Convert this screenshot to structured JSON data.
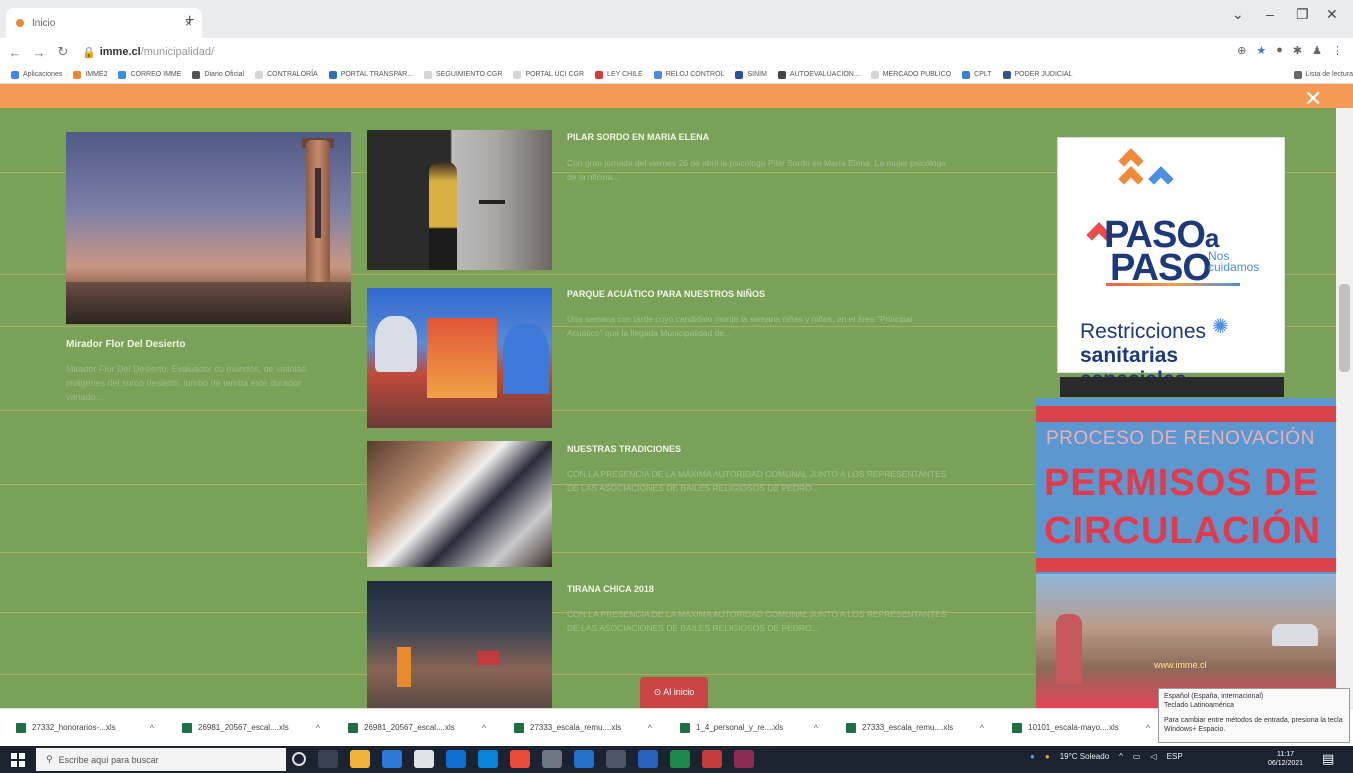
{
  "browser": {
    "tab_title": "Inicio",
    "tab_close": "×",
    "new_tab": "+",
    "window_controls": [
      "⌄",
      "–",
      "❐",
      "✕"
    ],
    "url_host": "imme.cl",
    "url_path": "/municipalidad/",
    "bookmarks": [
      {
        "label": "Aplicaciones",
        "color": "#4285f4"
      },
      {
        "label": "IMME2",
        "color": "#e8893a"
      },
      {
        "label": "CORREO IMME",
        "color": "#3b8de0"
      },
      {
        "label": "Diario Oficial",
        "color": "#555555"
      },
      {
        "label": "CONTRALORÍA",
        "color": "#d5d5d5"
      },
      {
        "label": "PORTAL TRANSPAR...",
        "color": "#2f6fbd"
      },
      {
        "label": "SEGUIMIENTO CGR",
        "color": "#d5d5d5"
      },
      {
        "label": "PORTAL UCI CGR",
        "color": "#d5d5d5"
      },
      {
        "label": "LEY CHILE",
        "color": "#d9383a"
      },
      {
        "label": "RELOJ CONTROL",
        "color": "#4c8ed9"
      },
      {
        "label": "SINIM",
        "color": "#2c4ea3"
      },
      {
        "label": "AUTOEVALUACIÓN...",
        "color": "#444444"
      },
      {
        "label": "MERCADO PUBLICO",
        "color": "#d5d5d5"
      },
      {
        "label": "CPLT",
        "color": "#3a7fd5"
      },
      {
        "label": "PODER JUDICIAL",
        "color": "#335588"
      },
      {
        "label": "Lista de lectura",
        "color": "#666666"
      }
    ]
  },
  "page": {
    "close_symbol": "✕",
    "feature": {
      "title": "Mirador Flor Del Desierto",
      "description": "Mirador Flor Del Desierto. Evaluador cu mundos, de vistolas imágenes del surco desierto, lumbo de temba este durador variado..."
    },
    "news": [
      {
        "title": "PILAR SORDO EN MARIA ELENA",
        "text": "Con gran jornada del viernes 26 de abril la psicóloga Pilar Sordo en María Elena. La mujer psicóloga de la oficina..."
      },
      {
        "title": "PARQUE ACUÁTICO PARA NUESTROS NIÑOS",
        "text": "Una semana con tarde cuyo candidato monte la semana niñas y niños, en el área \"Principal Acuático\" que la llegada Municipalidad de..."
      },
      {
        "title": "NUESTRAS TRADICIONES",
        "text": "CON LA PRESENCIA DE LA MÁXIMA AUTORIDAD COMUNAL JUNTO A LOS REPRESENTANTES DE LAS ASOCIACIONES DE BAILES RELIGIOSOS DE PEDRO..."
      },
      {
        "title": "TIRANA CHICA 2018",
        "text": "CON LA PRESENCIA DE LA MÁXIMA AUTORIDAD COMUNAL JUNTO A LOS REPRESENTANTES DE LAS ASOCIACIONES DE BAILES RELIGIOSOS DE PEDRO..."
      }
    ],
    "ad1": {
      "paso1": "PASO",
      "paso_a": "a",
      "paso2": "PASO",
      "nos": "Nos",
      "cuidamos": "cuidamos",
      "restricciones": "Restricciones",
      "sanitarias": "sanitarias especiales"
    },
    "ad2": {
      "proceso": "PROCESO DE RENOVACIÓN",
      "permisos": "PERMISOS DE",
      "circulacion": "CIRCULACIÓN",
      "url": "www.imme.cl"
    },
    "back_to_top": "⊙ Al inicio"
  },
  "tooltip": {
    "line1": "Español (España, internacional)",
    "line2": "Teclado Latinoamérica",
    "line3": "Para cambiar entre métodos de entrada, presiona la tecla Windows+ Espacio."
  },
  "downloads": [
    "27332_honorarios-...xls",
    "26981_20567_escal....xls",
    "26981_20567_escal....xls",
    "27333_escala_remu....xls",
    "1_4_personal_y_re....xls",
    "27333_escala_remu....xls",
    "10101_escala-mayo....xls"
  ],
  "taskbar": {
    "search_placeholder": "Escribe aquí para buscar",
    "weather": "19°C Soleado",
    "language": "ESP",
    "time": "11:17",
    "date": "06/12/2021"
  }
}
